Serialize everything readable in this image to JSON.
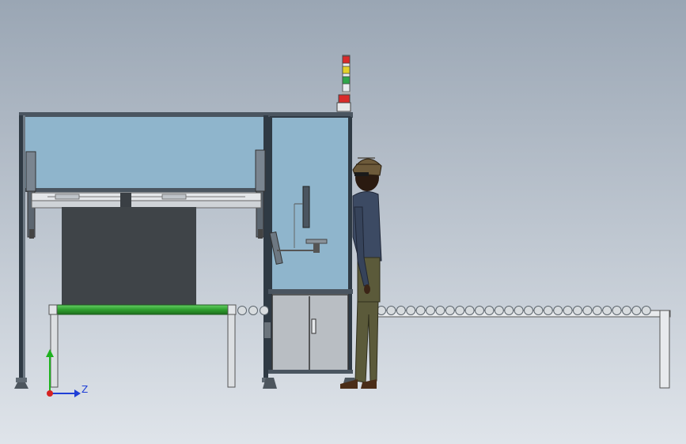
{
  "scene": {
    "background_top": "#9aa6b4",
    "background_bottom": "#dfe4ea",
    "glass_color": "#8fb5cc",
    "frame_color": "#3b4650",
    "conveyor_belt_color": "#2e9e2e",
    "cabinet_color": "#b9bec3",
    "tower_light_colors": [
      "#d92b2b",
      "#e3d12a",
      "#2fa64a",
      "#d92b2b"
    ]
  },
  "triad": {
    "z_label": "Z",
    "y_color": "#1fb11f",
    "z_color": "#1f3fd6",
    "origin_color": "#d62222"
  }
}
